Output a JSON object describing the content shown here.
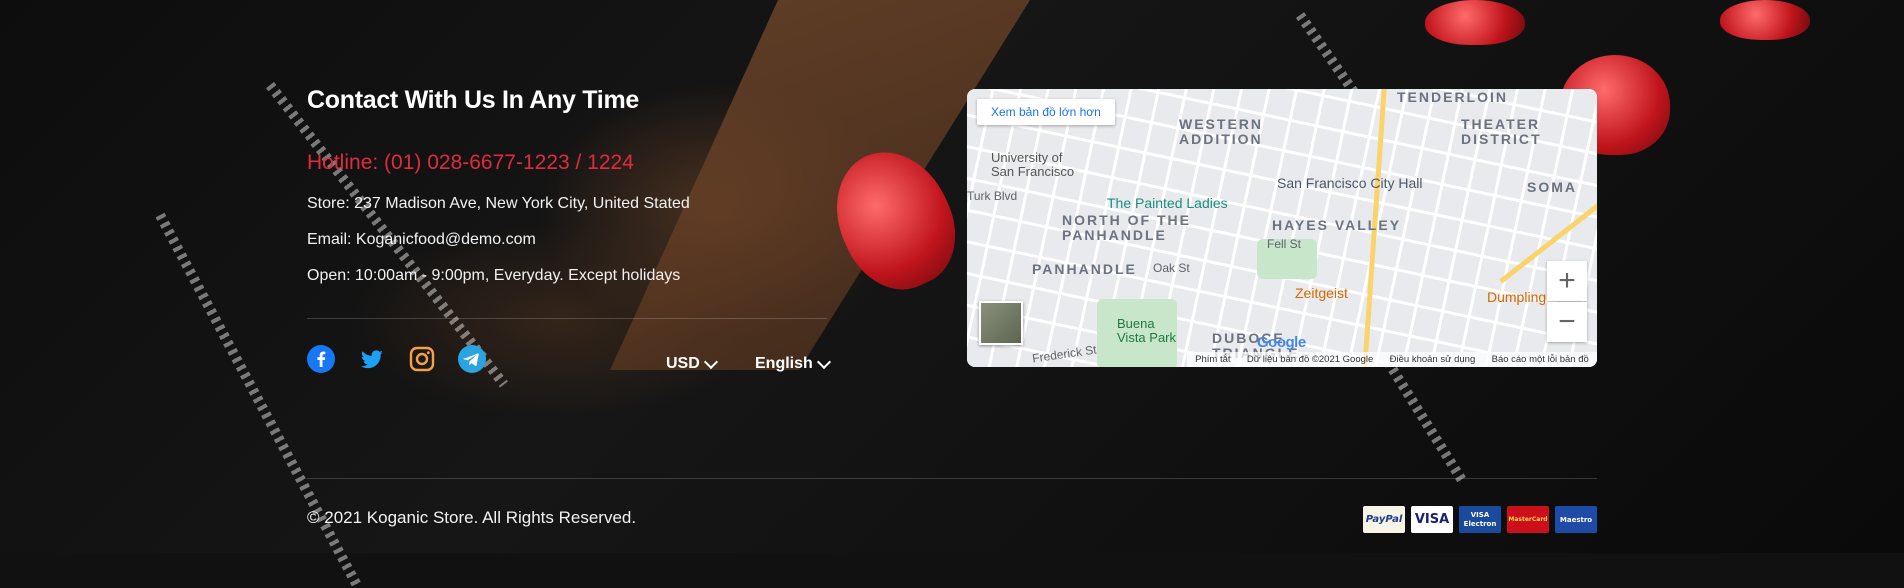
{
  "contact": {
    "heading": "Contact With Us In Any Time",
    "hotline": "Hotline: (01) 028-6677-1223 / 1224",
    "store": "Store: 237 Madison Ave, New York City, United Stated",
    "email": "Email: Koganicfood@demo.com",
    "open": "Open: 10:00am - 9:00pm, Everyday. Except holidays"
  },
  "social": [
    {
      "icon": "facebook-icon",
      "color": "#1877f2"
    },
    {
      "icon": "twitter-icon",
      "color": "#1da1f2"
    },
    {
      "icon": "instagram-icon",
      "color": "#f5a04a"
    },
    {
      "icon": "telegram-icon",
      "color": "#2aa3e0"
    }
  ],
  "selectors": {
    "currency": "USD",
    "language": "English"
  },
  "map": {
    "larger_map": "Xem bản đồ lớn hơn",
    "labels": {
      "tenderloin": "TENDERLOIN",
      "western_addition": "WESTERN\nADDITION",
      "theater_district": "THEATER\nDISTRICT",
      "university": "University of\nSan Francisco",
      "painted_ladies": "The Painted Ladies",
      "city_hall": "San Francisco City Hall",
      "soma": "SOMA",
      "north_panhandle": "NORTH OF THE\nPANHANDLE",
      "hayes_valley": "HAYES VALLEY",
      "panhandle": "PANHANDLE",
      "zeitgeist": "Zeitgeist",
      "dumpling": "Dumpling",
      "buena_vista": "Buena\nVista Park",
      "duboce": "DUBOCE\nTRIANGLE",
      "frederick": "Frederick St",
      "turk_blvd": "Turk Blvd",
      "fell_st": "Fell St",
      "oak_st": "Oak St"
    },
    "zoom_in": "+",
    "zoom_out": "−",
    "google": "Google",
    "attribution": [
      "Phím tắt",
      "Dữ liệu bản đồ ©2021 Google",
      "Điều khoản sử dụng",
      "Báo cáo một lỗi bản đồ"
    ]
  },
  "footer": {
    "copyright": "© 2021 Koganic Store. All Rights Reserved.",
    "payments": [
      "PayPal",
      "VISA",
      "VISA Electron",
      "MasterCard",
      "Maestro"
    ]
  }
}
